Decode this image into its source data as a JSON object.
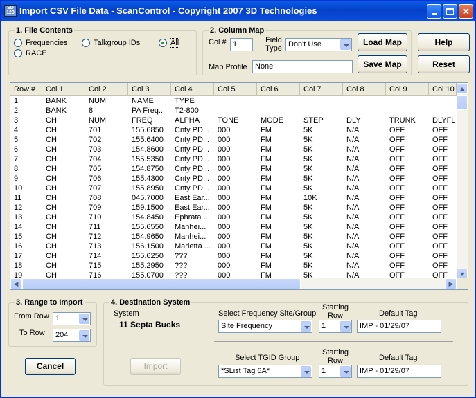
{
  "window": {
    "title": "Import CSV File Data - ScanControl - Copyright 2007 3D Technologies",
    "icon_text": "SD 123"
  },
  "file_contents": {
    "legend": "1. File Contents",
    "options": [
      {
        "label": "Frequencies",
        "selected": false
      },
      {
        "label": "Talkgroup IDs",
        "selected": false
      },
      {
        "label": "All",
        "selected": true
      },
      {
        "label": "RACE",
        "selected": false
      }
    ]
  },
  "column_map": {
    "legend": "2. Column Map",
    "col_label": "Col #",
    "col_value": "1",
    "field_type_label": "Field Type",
    "field_type_value": "Don't Use",
    "map_profile_label": "Map Profile",
    "map_profile_value": "None",
    "load_map": "Load Map",
    "save_map": "Save Map"
  },
  "buttons": {
    "help": "Help",
    "reset": "Reset",
    "cancel": "Cancel",
    "import": "Import"
  },
  "table": {
    "headers": [
      "Row #",
      "Col 1",
      "Col 2",
      "Col 3",
      "Col 4",
      "Col 5",
      "Col 6",
      "Col 7",
      "Col 8",
      "Col 9",
      "Col 10"
    ],
    "rows": [
      [
        "1",
        "BANK",
        "NUM",
        "NAME",
        "TYPE",
        "",
        "",
        "",
        "",
        "",
        ""
      ],
      [
        "2",
        "BANK",
        "8",
        "PA Freq...",
        "T2-800",
        "",
        "",
        "",
        "",
        "",
        ""
      ],
      [
        "3",
        "CH",
        "NUM",
        "FREQ",
        "ALPHA",
        "TONE",
        "MODE",
        "STEP",
        "DLY",
        "TRUNK",
        "DLYFL"
      ],
      [
        "4",
        "CH",
        "701",
        "155.6850",
        "Cnty PD...",
        "000",
        "FM",
        "5K",
        "N/A",
        "OFF",
        "OFF"
      ],
      [
        "5",
        "CH",
        "702",
        "155.6400",
        "Cnty PD...",
        "000",
        "FM",
        "5K",
        "N/A",
        "OFF",
        "OFF"
      ],
      [
        "6",
        "CH",
        "703",
        "154.8600",
        "Cnty PD...",
        "000",
        "FM",
        "5K",
        "N/A",
        "OFF",
        "OFF"
      ],
      [
        "7",
        "CH",
        "704",
        "155.5350",
        "Cnty PD...",
        "000",
        "FM",
        "5K",
        "N/A",
        "OFF",
        "OFF"
      ],
      [
        "8",
        "CH",
        "705",
        "154.8750",
        "Cnty PD...",
        "000",
        "FM",
        "5K",
        "N/A",
        "OFF",
        "OFF"
      ],
      [
        "9",
        "CH",
        "706",
        "155.4300",
        "Cnty PD...",
        "000",
        "FM",
        "5K",
        "N/A",
        "OFF",
        "OFF"
      ],
      [
        "10",
        "CH",
        "707",
        "155.8950",
        "Cnty PD...",
        "000",
        "FM",
        "5K",
        "N/A",
        "OFF",
        "OFF"
      ],
      [
        "11",
        "CH",
        "708",
        "045.7000",
        "East Ear...",
        "000",
        "FM",
        "10K",
        "N/A",
        "OFF",
        "OFF"
      ],
      [
        "12",
        "CH",
        "709",
        "159.1500",
        "East Ear...",
        "000",
        "FM",
        "5K",
        "N/A",
        "OFF",
        "OFF"
      ],
      [
        "13",
        "CH",
        "710",
        "154.8450",
        "Ephrata ...",
        "000",
        "FM",
        "5K",
        "N/A",
        "OFF",
        "OFF"
      ],
      [
        "14",
        "CH",
        "711",
        "155.6550",
        "Manhei...",
        "000",
        "FM",
        "5K",
        "N/A",
        "OFF",
        "OFF"
      ],
      [
        "15",
        "CH",
        "712",
        "154.9650",
        "Manhei...",
        "000",
        "FM",
        "5K",
        "N/A",
        "OFF",
        "OFF"
      ],
      [
        "16",
        "CH",
        "713",
        "156.1500",
        "Marietta ...",
        "000",
        "FM",
        "5K",
        "N/A",
        "OFF",
        "OFF"
      ],
      [
        "17",
        "CH",
        "714",
        "155.6250",
        "???",
        "000",
        "FM",
        "5K",
        "N/A",
        "OFF",
        "OFF"
      ],
      [
        "18",
        "CH",
        "715",
        "155.2950",
        "???",
        "000",
        "FM",
        "5K",
        "N/A",
        "OFF",
        "OFF"
      ],
      [
        "19",
        "CH",
        "716",
        "155.0700",
        "???",
        "000",
        "FM",
        "5K",
        "N/A",
        "OFF",
        "OFF"
      ]
    ]
  },
  "range": {
    "legend": "3. Range to Import",
    "from_label": "From Row",
    "from_value": "1",
    "to_label": "To Row",
    "to_value": "204"
  },
  "destination": {
    "legend": "4. Destination System",
    "system_label": "System",
    "system_value": "11 Septa Bucks",
    "freq_group_label": "Select Frequency Site/Group",
    "freq_group_value": "Site Frequency",
    "starting_row_label": "Starting Row",
    "freq_start_value": "1",
    "default_tag_label": "Default Tag",
    "freq_tag_value": "IMP - 01/29/07",
    "tgid_group_label": "Select TGID Group",
    "tgid_group_value": "*SList Tag 6A*",
    "tgid_start_value": "1",
    "tgid_tag_value": "IMP - 01/29/07"
  }
}
